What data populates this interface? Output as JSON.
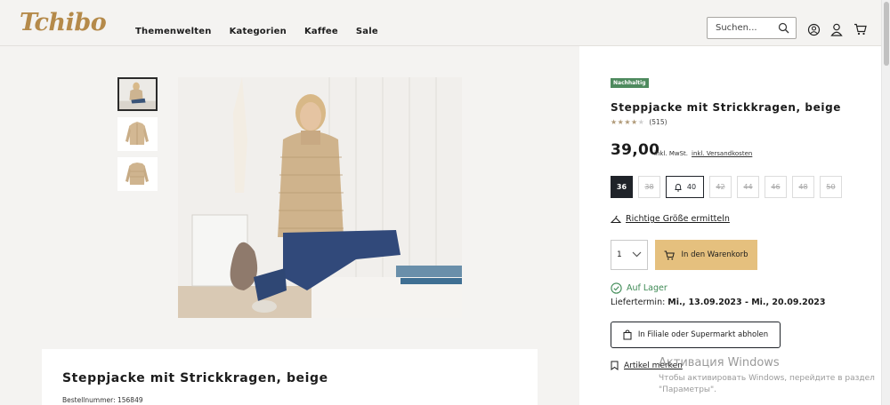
{
  "header": {
    "logo": "Tchibo",
    "nav": [
      "Themenwelten",
      "Kategorien",
      "Kaffee",
      "Sale"
    ],
    "search_placeholder": "Suchen..."
  },
  "product": {
    "badge": "Nachhaltig",
    "title": "Steppjacke mit Strickkragen, beige",
    "rating_value": 4,
    "rating_max": 5,
    "rating_count": "(515)",
    "price": "39,00",
    "vat": "inkl. MwSt.",
    "shipping_link": "inkl. Versandkosten",
    "sizes": [
      {
        "label": "36",
        "state": "selected"
      },
      {
        "label": "38",
        "state": "unavailable"
      },
      {
        "label": "40",
        "state": "notify"
      },
      {
        "label": "42",
        "state": "unavailable"
      },
      {
        "label": "44",
        "state": "unavailable"
      },
      {
        "label": "46",
        "state": "unavailable"
      },
      {
        "label": "48",
        "state": "unavailable"
      },
      {
        "label": "50",
        "state": "unavailable"
      }
    ],
    "fit_link": "Richtige Größe ermitteln",
    "quantity": "1",
    "cart_button": "In den Warenkorb",
    "stock": "Auf Lager",
    "delivery_label": "Liefertermin:",
    "delivery_dates": "Mi., 13.09.2023 - Mi., 20.09.2023",
    "store_button": "In Filiale oder Supermarkt abholen",
    "wishlist_link": "Artikel merken"
  },
  "description": {
    "title": "Steppjacke mit Strickkragen, beige",
    "order_number": "Bestellnummer: 156849"
  },
  "watermark": {
    "title": "Активация Windows",
    "line1": "Чтобы активировать Windows, перейдите в раздел",
    "line2": "\"Параметры\"."
  }
}
